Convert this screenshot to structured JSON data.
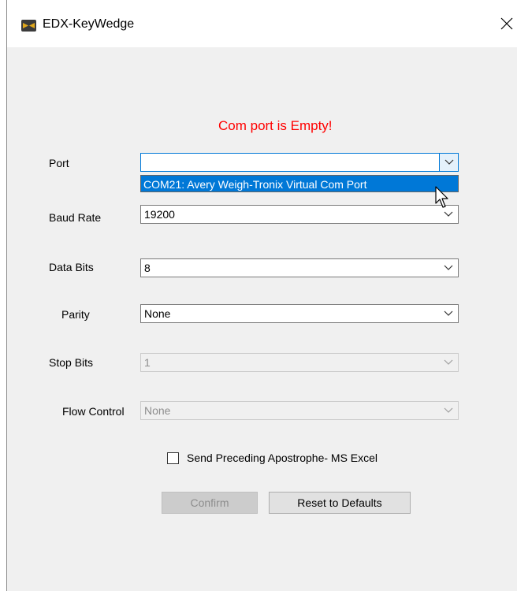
{
  "window": {
    "title": "EDX-KeyWedge"
  },
  "error_message": "Com port is Empty!",
  "fields": {
    "port": {
      "label": "Port",
      "value": ""
    },
    "baud_rate": {
      "label": "Baud Rate",
      "value": "19200"
    },
    "data_bits": {
      "label": "Data Bits",
      "value": "8"
    },
    "parity": {
      "label": "Parity",
      "value": "None"
    },
    "stop_bits": {
      "label": "Stop Bits",
      "value": "1"
    },
    "flow_control": {
      "label": "Flow Control",
      "value": "None"
    }
  },
  "port_dropdown": {
    "options": [
      "COM21: Avery Weigh-Tronix Virtual Com Port"
    ]
  },
  "checkbox": {
    "label": "Send Preceding Apostrophe- MS Excel",
    "checked": false
  },
  "buttons": {
    "confirm": "Confirm",
    "reset": "Reset to Defaults"
  },
  "colors": {
    "error": "#ff0000",
    "selection": "#0078d7"
  },
  "icons": {
    "app": "keywedge-app-icon",
    "close": "close-icon",
    "dropdown": "chevron-down-icon",
    "pointer": "mouse-pointer-icon"
  }
}
